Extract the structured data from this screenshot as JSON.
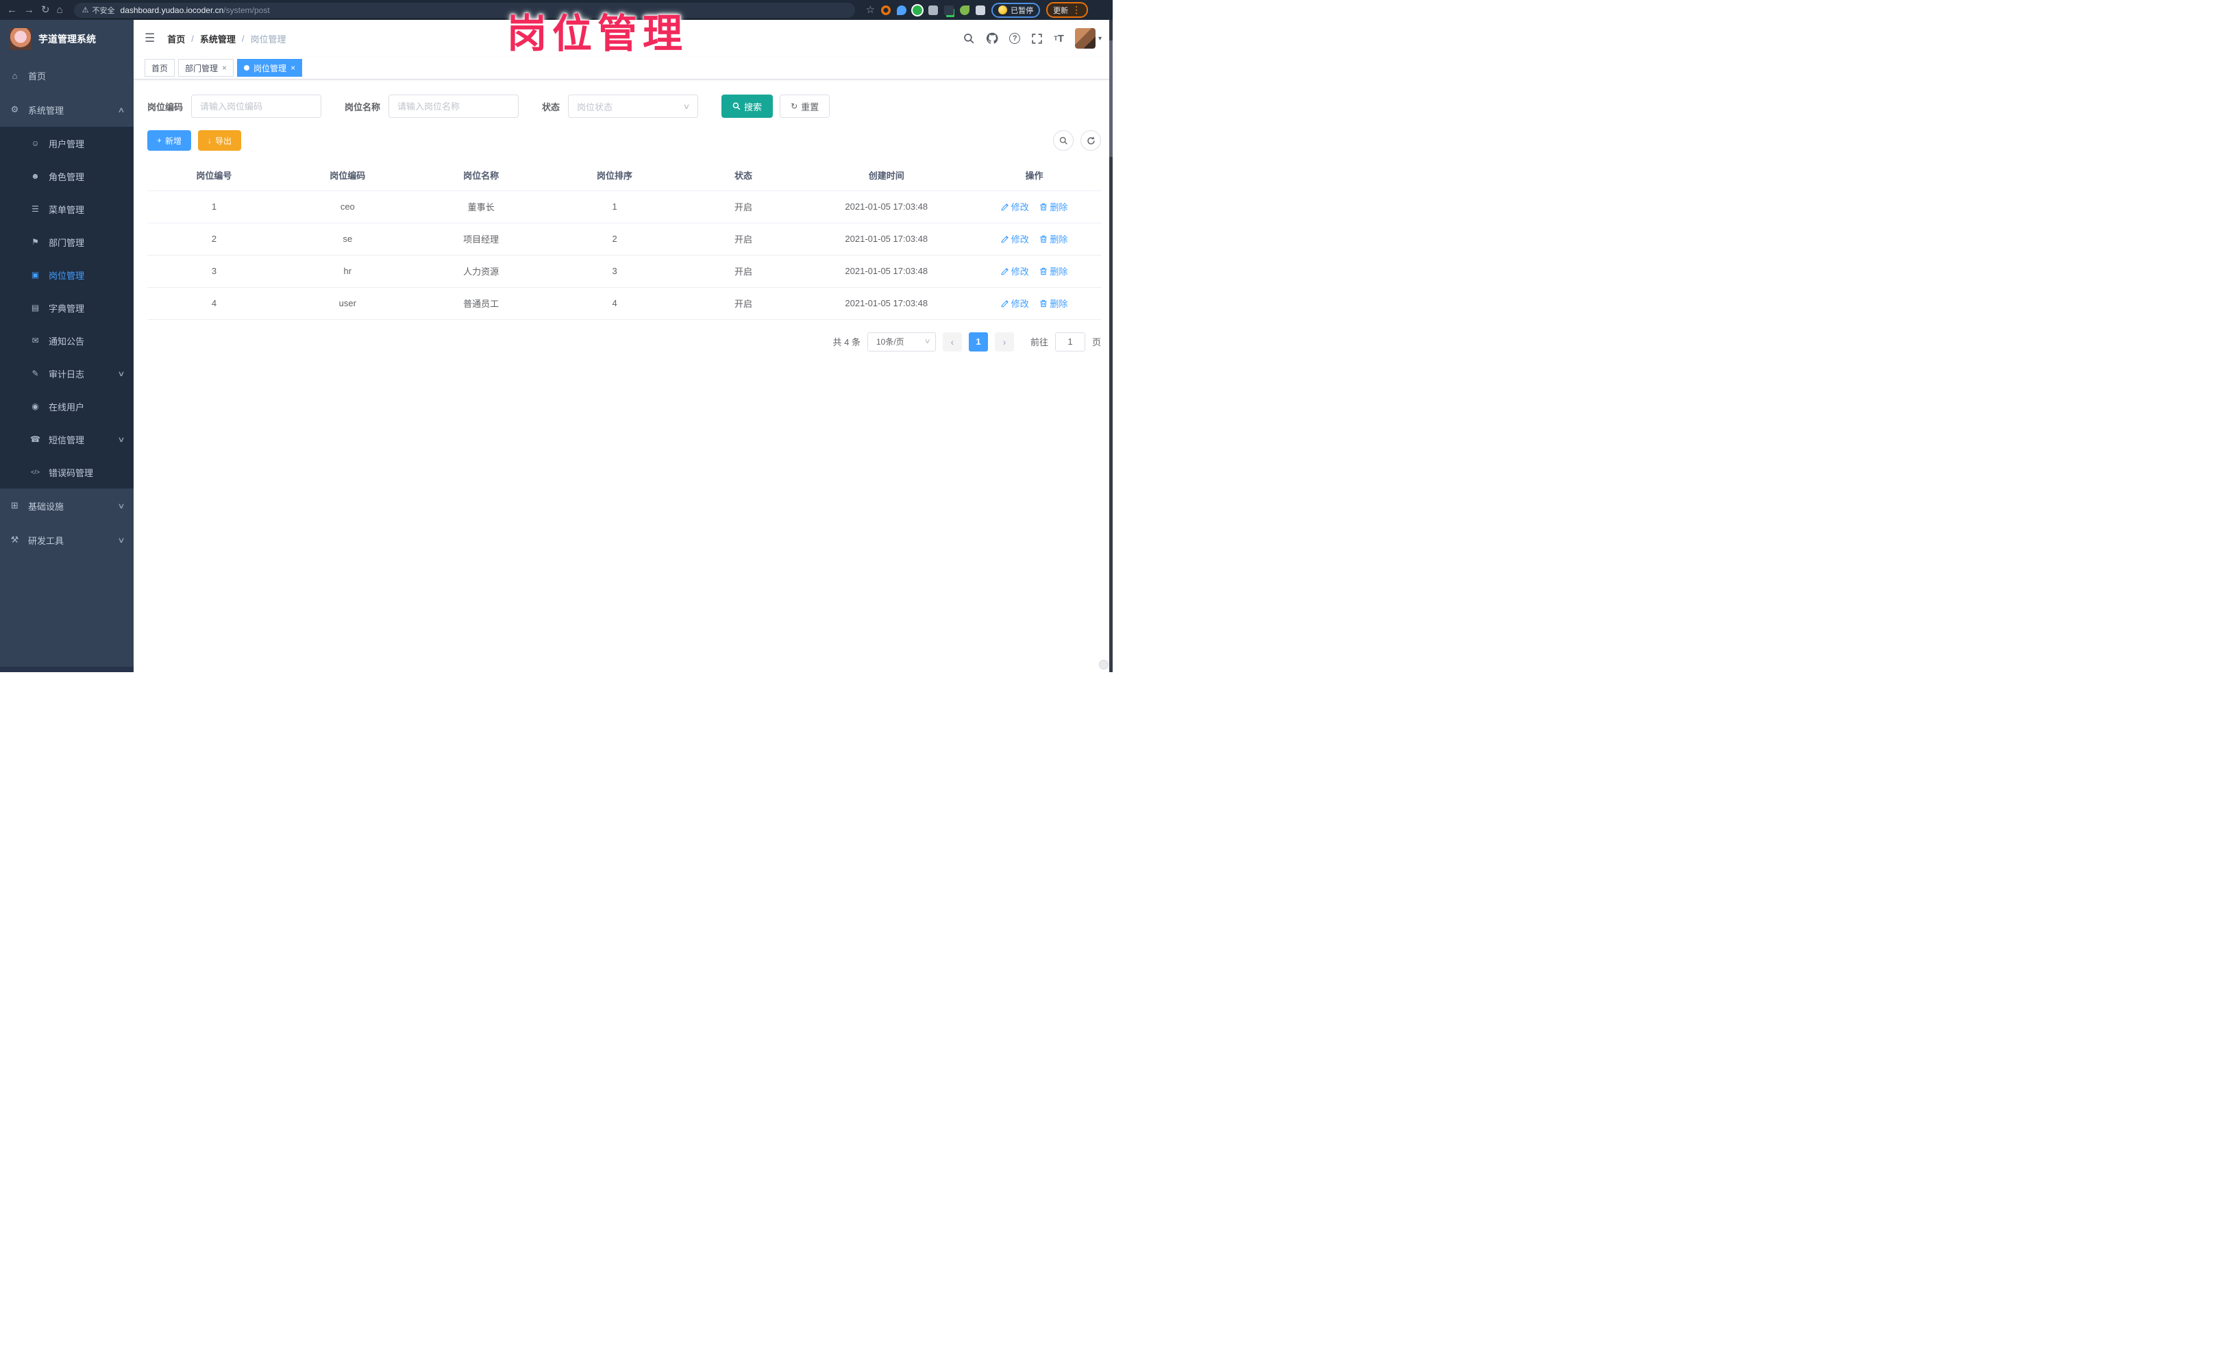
{
  "browser": {
    "security_label": "不安全",
    "url_host": "dashboard.yudao.iocoder.cn",
    "url_path": "/system/post",
    "paused_label": "已暂停",
    "update_label": "更新"
  },
  "overlay": {
    "text": "岗位管理"
  },
  "sidebar": {
    "app_title": "芋道管理系统",
    "items": [
      {
        "label": "首页",
        "icon": "home-menu-icon"
      },
      {
        "label": "系统管理",
        "icon": "gear-icon"
      },
      {
        "label": "用户管理",
        "icon": "user-icon"
      },
      {
        "label": "角色管理",
        "icon": "role-icon"
      },
      {
        "label": "菜单管理",
        "icon": "menu-list-icon"
      },
      {
        "label": "部门管理",
        "icon": "dept-tree-icon"
      },
      {
        "label": "岗位管理",
        "icon": "post-icon"
      },
      {
        "label": "字典管理",
        "icon": "dict-icon"
      },
      {
        "label": "通知公告",
        "icon": "notice-icon"
      },
      {
        "label": "审计日志",
        "icon": "audit-log-icon"
      },
      {
        "label": "在线用户",
        "icon": "online-user-icon"
      },
      {
        "label": "短信管理",
        "icon": "sms-icon"
      },
      {
        "label": "错误码管理",
        "icon": "error-code-icon"
      },
      {
        "label": "基础设施",
        "icon": "infra-icon"
      },
      {
        "label": "研发工具",
        "icon": "devtools-icon"
      }
    ]
  },
  "header": {
    "breadcrumb": [
      "首页",
      "系统管理",
      "岗位管理"
    ],
    "sep": "/"
  },
  "tabs": [
    {
      "label": "首页"
    },
    {
      "label": "部门管理"
    },
    {
      "label": "岗位管理"
    }
  ],
  "filter": {
    "code_label": "岗位编码",
    "code_placeholder": "请输入岗位编码",
    "name_label": "岗位名称",
    "name_placeholder": "请输入岗位名称",
    "status_label": "状态",
    "status_placeholder": "岗位状态",
    "search_label": "搜索",
    "reset_label": "重置"
  },
  "toolbar": {
    "add_label": "新增",
    "export_label": "导出"
  },
  "table": {
    "headers": [
      "岗位编号",
      "岗位编码",
      "岗位名称",
      "岗位排序",
      "状态",
      "创建时间",
      "操作"
    ],
    "edit_label": "修改",
    "delete_label": "删除",
    "rows": [
      {
        "id": "1",
        "code": "ceo",
        "name": "董事长",
        "sort": "1",
        "status": "开启",
        "created": "2021-01-05 17:03:48"
      },
      {
        "id": "2",
        "code": "se",
        "name": "项目经理",
        "sort": "2",
        "status": "开启",
        "created": "2021-01-05 17:03:48"
      },
      {
        "id": "3",
        "code": "hr",
        "name": "人力资源",
        "sort": "3",
        "status": "开启",
        "created": "2021-01-05 17:03:48"
      },
      {
        "id": "4",
        "code": "user",
        "name": "普通员工",
        "sort": "4",
        "status": "开启",
        "created": "2021-01-05 17:03:48"
      }
    ]
  },
  "pagination": {
    "total_label": "共 4 条",
    "page_size": "10条/页",
    "current_page": "1",
    "goto_label": "前往",
    "goto_value": "1",
    "page_unit": "页"
  },
  "colors": {
    "primary": "#409EFF",
    "search_teal": "#17A797",
    "export_orange": "#F5A623",
    "overlay_pink": "#F2295B",
    "sidebar_bg": "#334257",
    "submenu_bg": "#202D3F"
  },
  "icon_glyphs": {
    "back-icon": "←",
    "forward-icon": "→",
    "reload-icon": "↻",
    "home-icon": "⌂",
    "warning-icon": "⚠",
    "star-icon": "☆",
    "more-icon": "⋮",
    "hamburger-icon": "☰",
    "home-menu-icon": "⌂",
    "gear-icon": "⚙",
    "user-icon": "☺",
    "role-icon": "☻",
    "menu-list-icon": "☰",
    "dept-tree-icon": "⚑",
    "post-icon": "▣",
    "dict-icon": "▤",
    "notice-icon": "✉",
    "audit-log-icon": "✎",
    "online-user-icon": "◉",
    "sms-icon": "☎",
    "error-code-icon": "</>",
    "infra-icon": "⊞",
    "devtools-icon": "⚒",
    "chevron-up-icon": "∧",
    "chevron-down-icon": "∨",
    "caret-down-icon": "▾",
    "font-size-icon": "T",
    "plus-icon": "+",
    "download-icon": "↓",
    "reset-icon": "↻",
    "edit-icon": "✎",
    "prev-icon": "‹",
    "next-icon": "›",
    "close-icon": "×"
  }
}
